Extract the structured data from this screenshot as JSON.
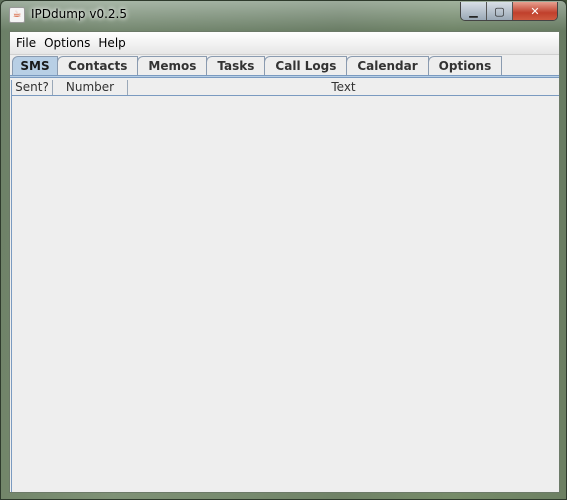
{
  "window": {
    "title": "IPDdump v0.2.5",
    "controls": [
      "minimize",
      "maximize",
      "close"
    ]
  },
  "menu": [
    "File",
    "Options",
    "Help"
  ],
  "tabs": [
    {
      "label": "SMS",
      "active": true
    },
    {
      "label": "Contacts"
    },
    {
      "label": "Memos"
    },
    {
      "label": "Tasks"
    },
    {
      "label": "Call Logs"
    },
    {
      "label": "Calendar"
    },
    {
      "label": "Options"
    }
  ],
  "table": {
    "columns": [
      "Sent?",
      "Number",
      "Text"
    ],
    "rows": []
  },
  "colors": {
    "active_tab": "#b8cfe5",
    "close_button": "#c0402c"
  }
}
